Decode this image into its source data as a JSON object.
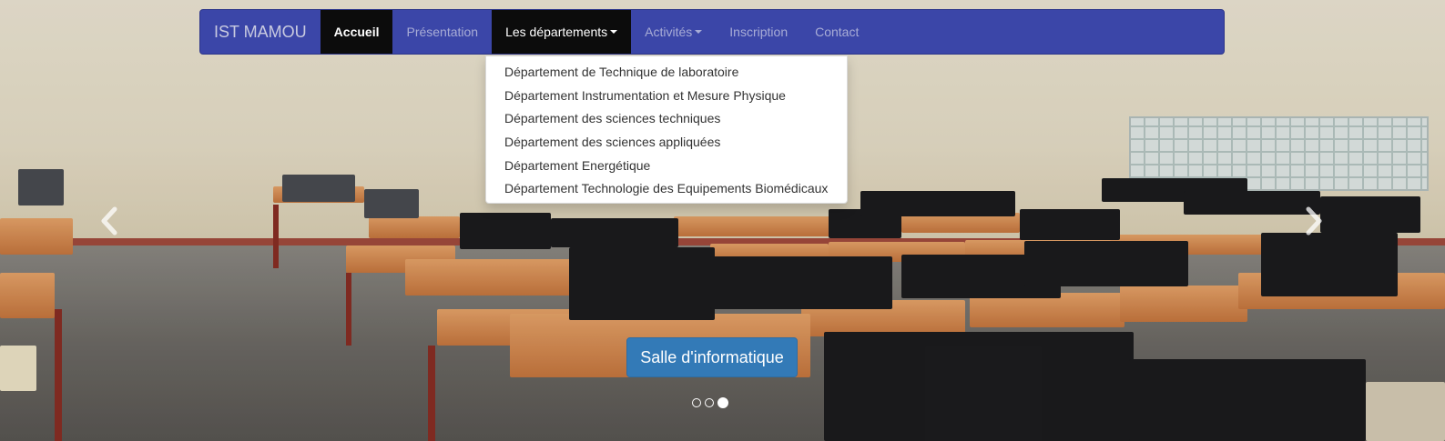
{
  "navbar": {
    "brand": "IST MAMOU",
    "items": [
      {
        "label": "Accueil",
        "state": "active"
      },
      {
        "label": "Présentation",
        "state": "normal"
      },
      {
        "label": "Les départements",
        "state": "open",
        "caret": true
      },
      {
        "label": "Activités",
        "state": "normal",
        "caret": true
      },
      {
        "label": "Inscription",
        "state": "normal"
      },
      {
        "label": "Contact",
        "state": "normal"
      }
    ]
  },
  "dropdown": {
    "items": [
      "Département de Technique de laboratoire",
      "Département Instrumentation et Mesure Physique",
      "Département des sciences techniques",
      "Département des sciences appliquées",
      "Département Energétique",
      "Département Technologie des Equipements Biomédicaux"
    ]
  },
  "carousel": {
    "caption": "Salle d'informatique",
    "slide_count": 3,
    "active_slide": 3,
    "prev_icon": "chevron-left-icon",
    "next_icon": "chevron-right-icon"
  },
  "colors": {
    "navbar_bg": "#3b46a8",
    "active_bg": "#0c0c0c",
    "caption_bg": "#337ab7"
  }
}
